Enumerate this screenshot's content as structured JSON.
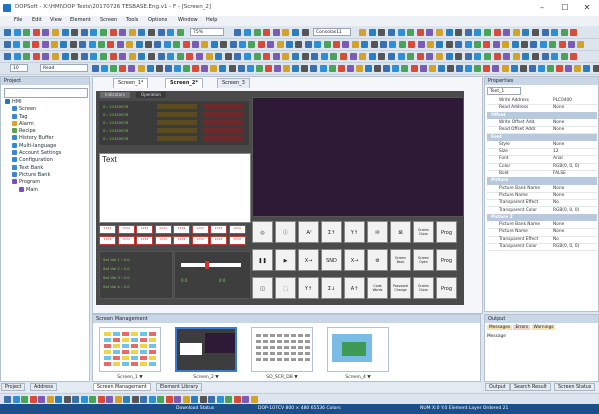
{
  "window": {
    "title": "DOPSoft - X:\\HMI\\DOP Tests\\20170726 TESBASE.Eng.v1 - F - [Screen_2]",
    "min": "–",
    "max": "☐",
    "close": "✕"
  },
  "menu": [
    "File",
    "Edit",
    "View",
    "Element",
    "Screen",
    "Tools",
    "Options",
    "Window",
    "Help"
  ],
  "toolbar": {
    "zoom": "75%",
    "font": "Consolas11",
    "size": "10",
    "style": "Read"
  },
  "project_panel": {
    "title": "Project",
    "tree": [
      {
        "label": "HMI",
        "indent": 0,
        "color": "#2f6fb7"
      },
      {
        "label": "Screen",
        "indent": 1,
        "color": "#3a86d6"
      },
      {
        "label": "Tag",
        "indent": 1,
        "color": "#3a86d6"
      },
      {
        "label": "Alarm",
        "indent": 1,
        "color": "#e0a22a"
      },
      {
        "label": "Recipe",
        "indent": 1,
        "color": "#5aa34a"
      },
      {
        "label": "History Buffer",
        "indent": 1,
        "color": "#3a86d6"
      },
      {
        "label": "Multi-language",
        "indent": 1,
        "color": "#3a86d6"
      },
      {
        "label": "Account Settings",
        "indent": 1,
        "color": "#3a86d6"
      },
      {
        "label": "Configuration",
        "indent": 1,
        "color": "#3a86d6"
      },
      {
        "label": "Text Bank",
        "indent": 1,
        "color": "#3a86d6"
      },
      {
        "label": "Picture Bank",
        "indent": 1,
        "color": "#3a86d6"
      },
      {
        "label": "Program",
        "indent": 1,
        "color": "#7a4ec2"
      },
      {
        "label": "Main",
        "indent": 2,
        "color": "#7a4ec2"
      }
    ],
    "bottom_tabs": [
      "Project",
      "Address"
    ]
  },
  "editor": {
    "tabs": [
      "Screen_1*",
      "Screen_2*",
      "Screen_3"
    ],
    "sub_tabs": [
      "Indicators",
      "Operation"
    ],
    "text_box": "Text",
    "readouts": [
      "0 : 12345678",
      "0 : 12345678",
      "0 : 12345678",
      "0 : 12345678",
      "0 : 12345678"
    ],
    "numbers": [
      "1234",
      "1234",
      "1234",
      "1234",
      "1234",
      "1234",
      "1234",
      "1234",
      "1234",
      "1234",
      "1234",
      "1234",
      "1234",
      "1234",
      "1234",
      "1234"
    ],
    "vals": [
      "Set Val 1 : 0.0",
      "Set Val 2 : 0.0",
      "Set Val 3 : 0.0",
      "Set Val 4 : 0.0"
    ],
    "gauge_vals": [
      "0.0",
      "0.0"
    ],
    "btn_row1": [
      "◎",
      "ⓘ",
      "A⁄",
      "Σ↑",
      "Y↑",
      "✉",
      "⊠",
      "Screen\nClose",
      "Prog"
    ],
    "btn_row2": [
      "❚❚",
      "▶",
      "X→",
      "SND",
      "X→",
      "⚙",
      "Screen\nBack",
      "Screen\nOpen",
      "Prog"
    ],
    "btn_row3": [
      "◫",
      "⬚",
      "Y↑",
      "Σ↓",
      "A↑",
      "Code\nWords",
      "Password\nChange",
      "Screen\nClose",
      "Prog"
    ]
  },
  "properties": {
    "title": "Properties",
    "selected": "Text_1",
    "rows": [
      {
        "k": "Write Address",
        "v": "PLC0400"
      },
      {
        "k": "Read Address",
        "v": "None"
      },
      {
        "cat": "Offset"
      },
      {
        "k": "Write Offset Add.",
        "v": "None"
      },
      {
        "k": "Read Offset Addr.",
        "v": "None"
      },
      {
        "cat": "Font"
      },
      {
        "k": "Style",
        "v": "None"
      },
      {
        "k": "Size",
        "v": "12"
      },
      {
        "k": "Font",
        "v": "Arial"
      },
      {
        "k": "Color",
        "v": "RGB(0, 0, 0)"
      },
      {
        "k": "Bold",
        "v": "FALSE"
      },
      {
        "cat": "Picture"
      },
      {
        "k": "Picture Bank Name",
        "v": "None"
      },
      {
        "k": "Picture Name",
        "v": "None"
      },
      {
        "k": "Transparent Effect",
        "v": "No"
      },
      {
        "k": "Transparent Color",
        "v": "RGB(0, 0, 0)"
      },
      {
        "cat": "Picture 2"
      },
      {
        "k": "Picture Bank Name",
        "v": "None"
      },
      {
        "k": "Picture Name",
        "v": "None"
      },
      {
        "k": "Transparent Effect",
        "v": "No"
      },
      {
        "k": "Transparent Color",
        "v": "RGB(0, 0, 0)"
      }
    ]
  },
  "output": {
    "title": "Output",
    "tabs": [
      "Messages",
      "Errors",
      "Warnings"
    ],
    "header": "Message",
    "bottom_tabs": [
      "Output",
      "Search Result",
      "Screen Status"
    ]
  },
  "screen_management": {
    "title": "Screen Management",
    "thumbs": [
      "Screen_1 ▼",
      "Screen_2 ▼",
      "SO_SCR_DB ▼",
      "Screen_4 ▼"
    ],
    "bottom_tabs": [
      "Screen Management",
      "Element Library"
    ]
  },
  "status": {
    "left": "Download Status",
    "mid": "DOP-107CV 800 × 480 65536 Colors",
    "right": "NUM  X:0 Y:0  Element Layer Ordered 21"
  }
}
